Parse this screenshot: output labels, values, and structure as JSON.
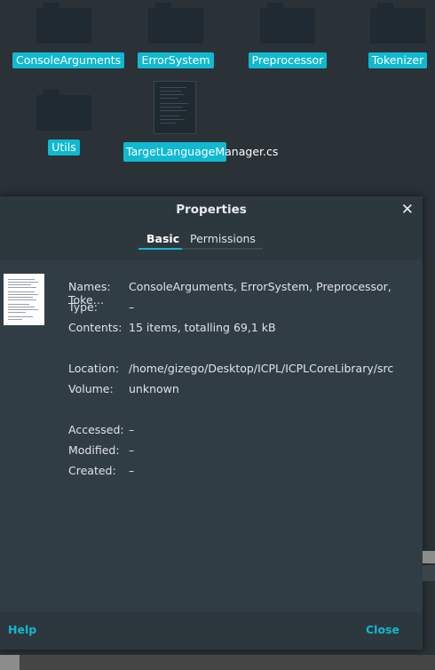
{
  "files": [
    {
      "label": "ConsoleArguments",
      "kind": "folder"
    },
    {
      "label": "ErrorSystem",
      "kind": "folder"
    },
    {
      "label": "Preprocessor",
      "kind": "folder"
    },
    {
      "label": "Tokenizer",
      "kind": "folder"
    },
    {
      "label": "Utils",
      "kind": "folder"
    },
    {
      "label": "TargetLanguageManager.cs",
      "kind": "file"
    }
  ],
  "dialog": {
    "title": "Properties",
    "close_icon": "close-icon",
    "tabs": [
      {
        "label": "Basic",
        "active": true
      },
      {
        "label": "Permissions",
        "active": false
      }
    ],
    "props": {
      "names_label": "Names:",
      "names_value": "ConsoleArguments, ErrorSystem, Preprocessor, Toke…",
      "type_label": "Type:",
      "type_value": "–",
      "contents_label": "Contents:",
      "contents_value": "15 items, totalling 69,1 kB",
      "location_label": "Location:",
      "location_value": "/home/gizego/Desktop/ICPL/ICPLCoreLibrary/src",
      "volume_label": "Volume:",
      "volume_value": "unknown",
      "accessed_label": "Accessed:",
      "accessed_value": "–",
      "modified_label": "Modified:",
      "modified_value": "–",
      "created_label": "Created:",
      "created_value": "–"
    },
    "footer": {
      "help_label": "Help",
      "close_label": "Close"
    }
  },
  "colors": {
    "accent": "#10b9d0",
    "dialog_bg": "#313d45",
    "background": "#2a3237"
  }
}
